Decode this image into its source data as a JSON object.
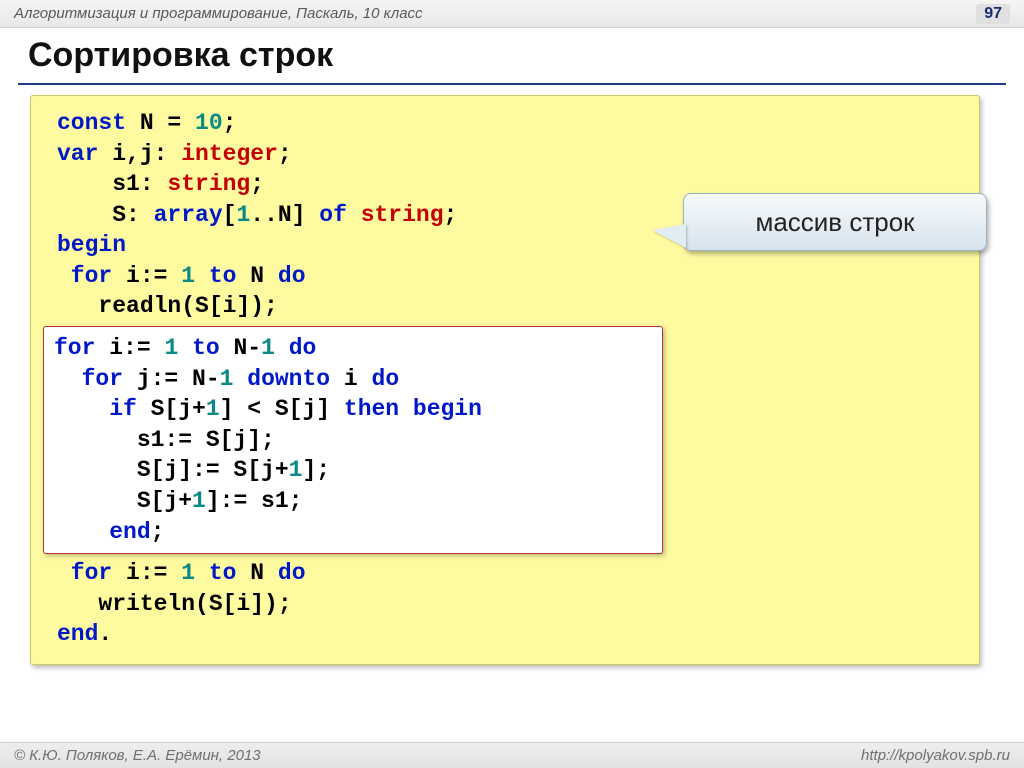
{
  "header": {
    "breadcrumb": "Алгоритмизация и программирование, Паскаль, 10 класс",
    "page_number": "97"
  },
  "title": "Сортировка строк",
  "callout": "массив строк",
  "code": {
    "line1_const": "const",
    "line1_N": " N",
    "line1_eq": " = ",
    "line1_10": "10",
    "line1_semi": ";",
    "line2_var": "var",
    "line2_rest": " i,j: ",
    "line2_type": "integer",
    "line2_end": ";",
    "line3_pad": "    s1: ",
    "line3_type": "string",
    "line3_end": ";",
    "line4_pad": "    S: ",
    "line4_array": "array",
    "line4_b1": "[",
    "line4_1": "1",
    "line4_dots": "..N] ",
    "line4_of": "of",
    "line4_sp": " ",
    "line4_type": "string",
    "line4_end": ";",
    "line5_begin": "begin",
    "line6_for": " for",
    "line6_i": " i:=",
    "line6_sp": " ",
    "line6_1": "1",
    "line6_to": " to",
    "line6_N": " N ",
    "line6_do": "do",
    "line7_read": "   readln(S[i]);",
    "inner1_for": "for",
    "inner1_i": " i:=",
    "inner1_sp": " ",
    "inner1_1": "1",
    "inner1_to": " to",
    "inner1_n1": " N-",
    "inner1_one": "1",
    "inner1_do": " do",
    "inner2_for": "  for",
    "inner2_j": " j:=",
    "inner2_sp": " ",
    "inner2_n1a": "N-",
    "inner2_1": "1",
    "inner2_downto": " downto",
    "inner2_i": " i ",
    "inner2_do": "do",
    "inner3_if": "    if",
    "inner3_cond": " S[j+",
    "inner3_1a": "1",
    "inner3_mid": "] < S[j] ",
    "inner3_then": "then begin",
    "inner4": "      s1:= S[j];",
    "inner5a": "      S[j]:= S[j+",
    "inner5_1": "1",
    "inner5b": "];",
    "inner6a": "      S[j+",
    "inner6_1": "1",
    "inner6b": "]:= s1;",
    "inner7_end": "    end",
    "inner7_semi": ";",
    "line8_for": " for",
    "line8_i": " i:=",
    "line8_sp": " ",
    "line8_1": "1",
    "line8_to": " to",
    "line8_N": " N ",
    "line8_do": "do",
    "line9_write": "   writeln(S[i]);",
    "line10_end": "end",
    "line10_dot": "."
  },
  "footer": {
    "left": "© К.Ю. Поляков, Е.А. Ерёмин, 2013",
    "right": "http://kpolyakov.spb.ru"
  }
}
